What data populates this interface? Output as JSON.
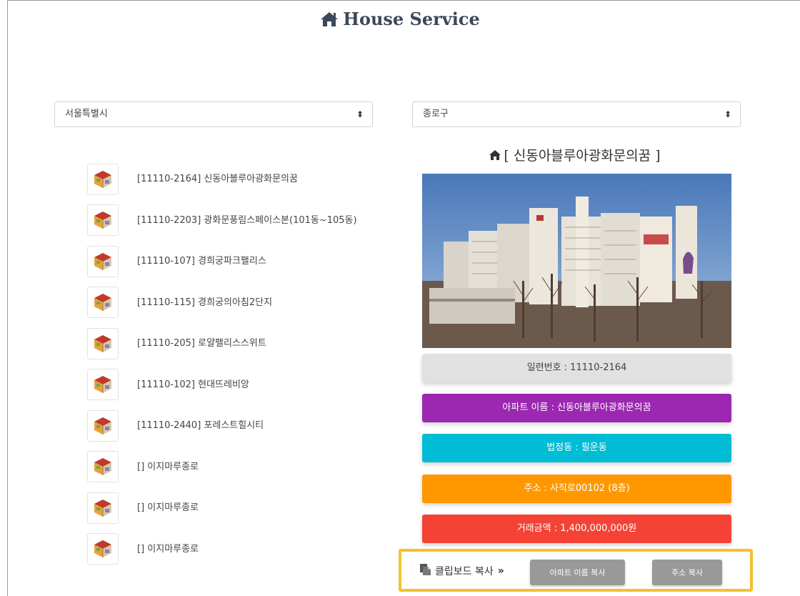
{
  "header": {
    "title": "House Service"
  },
  "filters": {
    "city": {
      "selected": "서울특별시"
    },
    "district": {
      "selected": "종로구"
    }
  },
  "apartments": [
    {
      "label": "[11110-2164] 신동아블루아광화문의꿈"
    },
    {
      "label": "[11110-2203] 광화문풍림스페이스본(101동~105동)"
    },
    {
      "label": "[11110-107] 경희궁파크팰리스"
    },
    {
      "label": "[11110-115] 경희궁의아침2단지"
    },
    {
      "label": "[11110-205] 로얄팰리스스위트"
    },
    {
      "label": "[11110-102] 현대뜨레비앙"
    },
    {
      "label": "[11110-2440] 포레스트힐시티"
    },
    {
      "label": "[] 이지마루종로"
    },
    {
      "label": "[] 이지마루종로"
    },
    {
      "label": "[] 이지마루종로"
    }
  ],
  "detail": {
    "title": "[ 신동아블루아광화문의꿈 ]",
    "serial": "일련번호 : 11110-2164",
    "apt_name": "아파트 이름 : 신동아블루아광화문의꿈",
    "dong": "법정동 : 필운동",
    "address": "주소 : 사직로00102 (8층)",
    "price": "거래금액 : 1,400,000,000원"
  },
  "clipboard": {
    "label": "클립보드 복사",
    "copy_name_button": "아파트 이름 복사",
    "copy_address_button": "주소 복사"
  },
  "colors": {
    "serial_bar": "#e1e1e1",
    "name_bar": "#9c27b0",
    "dong_bar": "#00bcd4",
    "address_bar": "#ff9800",
    "price_bar": "#f44336",
    "highlight_border": "#f5c02b",
    "copy_button": "#999999"
  },
  "icons": {
    "title": "home-icon",
    "apartment_thumb": "apartment-3d-icon",
    "detail_title": "home-icon",
    "clipboard": "copy-icon",
    "chevron": "double-chevron-right-icon"
  }
}
